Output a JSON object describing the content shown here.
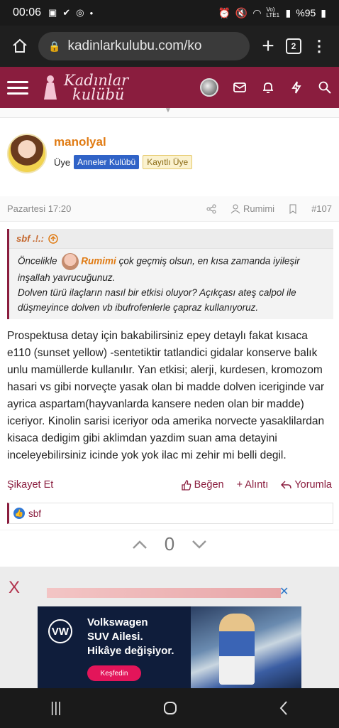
{
  "status_bar": {
    "time": "00:06",
    "network": "Vo) LTE1",
    "battery": "%95"
  },
  "browser": {
    "url": "kadinlarkulubu.com/ko",
    "tab_count": "2"
  },
  "site": {
    "logo_line1": "Kadınlar",
    "logo_line2": "kulübü",
    "brand_color": "#8a1d3e"
  },
  "post": {
    "author": "manolyal",
    "role": "Üye",
    "badge1": "Anneler Kulübü",
    "badge2": "Kayıtlı Üye",
    "date": "Pazartesi 17:20",
    "mention_label": "Rumimi",
    "post_number": "#107",
    "quote": {
      "author": "sbf .!.:",
      "line1_pre": "Öncelikle",
      "line1_mention": "Rumimi",
      "line1_post": "çok geçmiş olsun, en kısa zamanda iyileşir inşallah yavrucuğunuz.",
      "line2": "Dolven türü ilaçların nasıl bir etkisi oluyor? Açıkçası ateş calpol ile düşmeyince dolven vb ibufrofenlerle çapraz kullanıyoruz."
    },
    "body": "Prospektusa detay için bakabilirsiniz epey detaylı fakat kısaca e110 (sunset yellow) -sentetiktir tatlandici gidalar konserve balık unlu mamüllerde kullanılır. Yan etkisi; alerji, kurdesen, kromozom hasari vs gibi norveçte yasak olan bi madde dolven iceriginde var ayrica aspartam(hayvanlarda kansere neden olan bir madde) iceriyor. Kinolin sarisi iceriyor oda amerika norvecte yasaklilardan kisaca dedigim gibi aklimdan yazdim suan ama detayini inceleyebilirsiniz icinde yok yok ilac mi zehir mi belli degil.",
    "report": "Şikayet Et",
    "like": "Beğen",
    "quote_action": "+ Alıntı",
    "reply": "Yorumla",
    "liked_by": "sbf",
    "vote_count": "0"
  },
  "ad": {
    "close_label": "X",
    "brand": "VW",
    "line1": "Volkswagen",
    "line2": "SUV Ailesi.",
    "line3": "Hikâye değişiyor.",
    "cta": "Keşfedin"
  }
}
